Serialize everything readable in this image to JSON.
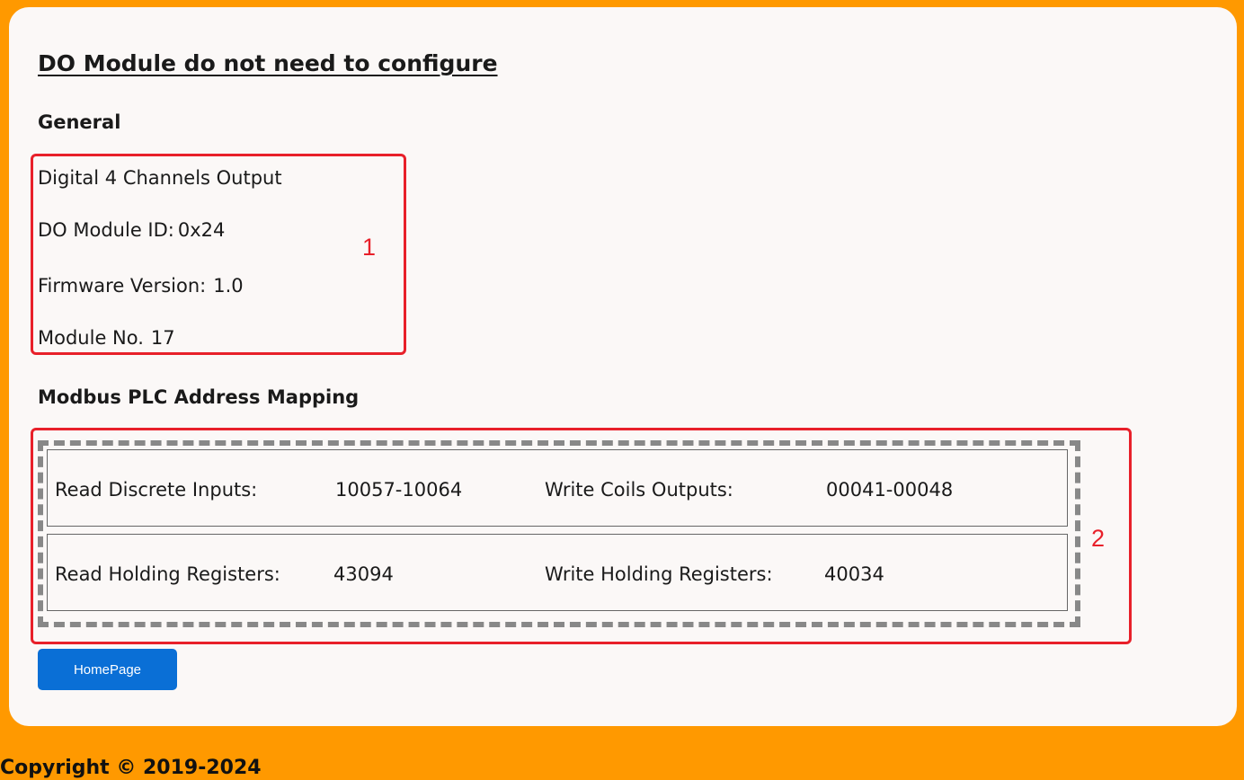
{
  "page": {
    "title": "DO Module do not need to configure"
  },
  "general": {
    "heading": "General",
    "module_type": "Digital 4 Channels Output",
    "module_id_label": "DO Module ID:",
    "module_id_value": "0x24",
    "firmware_label": "Firmware Version:",
    "firmware_value": "1.0",
    "module_no_label": "Module No.",
    "module_no_value": "17",
    "marker": "1"
  },
  "modbus": {
    "heading": "Modbus PLC Address Mapping",
    "marker": "2",
    "rows": [
      {
        "read_label": "Read Discrete Inputs:",
        "read_value": "10057-10064",
        "write_label": "Write Coils Outputs:",
        "write_value": "00041-00048"
      },
      {
        "read_label": "Read Holding Registers:",
        "read_value": "43094",
        "write_label": "Write Holding Registers:",
        "write_value": "40034"
      }
    ]
  },
  "actions": {
    "homepage_label": "HomePage"
  },
  "footer": {
    "copyright": "Copyright © 2019-2024"
  },
  "colors": {
    "background": "#ff9900",
    "card": "#fbf8f7",
    "annotation": "#e8202a",
    "button": "#0a6fd6"
  }
}
